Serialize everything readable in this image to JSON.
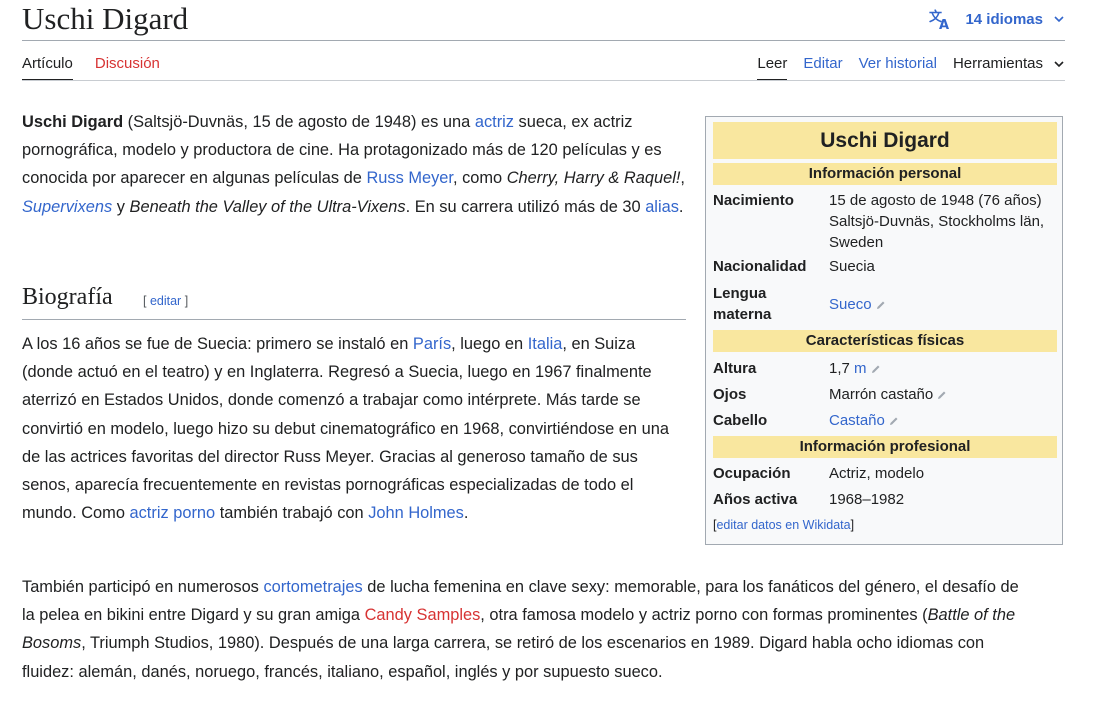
{
  "header": {
    "title": "Uschi Digard",
    "languages": "14 idiomas"
  },
  "tabs": {
    "articulo": "Artículo",
    "discusion": "Discusión",
    "leer": "Leer",
    "editar": "Editar",
    "historial": "Ver historial",
    "herramientas": "Herramientas"
  },
  "intro": {
    "name": "Uschi Digard",
    "t1": " (Saltsjö-Duvnäs, 15 de agosto de 1948) es una ",
    "l_actriz": "actriz",
    "t2": " sueca, ex actriz pornográfica, modelo y productora de cine. Ha protagonizado más de 120 películas y es conocida por aparecer en algunas películas de ",
    "l_russ": "Russ Meyer",
    "t3": ", como ",
    "i_cherry": "Cherry, Harry & Raquel!",
    "t4": ", ",
    "l_super": "Supervixens",
    "t5": " y ",
    "i_beneath": "Beneath the Valley of the Ultra-Vixens",
    "t6": ". En su carrera utilizó más de 30 ",
    "l_alias": "alias",
    "t7": "."
  },
  "section": {
    "heading": "Biografía",
    "edit_open": "[ ",
    "edit_link": "editar",
    "edit_close": " ]"
  },
  "bio": {
    "t1": "A los 16 años se fue de Suecia: primero se instaló en ",
    "l_paris": "París",
    "t2": ", luego en ",
    "l_italia": "Italia",
    "t3": ", en Suiza (donde actuó en el teatro) y en Inglaterra. Regresó a Suecia, luego en 1967 finalmente aterrizó en Estados Unidos, donde comenzó a trabajar como intérprete. Más tarde se convirtió en modelo, luego hizo su debut cinematográfico en 1968, convirtiéndose en una de las actrices favoritas del director Russ Meyer. Gracias al generoso tamaño de sus senos, aparecía frecuentemente en revistas pornográficas especializadas de todo el mundo. Como ",
    "l_porno": "actriz porno",
    "t4": " también trabajó con ",
    "l_john": "John Holmes",
    "t5": "."
  },
  "bio2": {
    "t1": "También participó en numerosos ",
    "l_corto": "cortometrajes",
    "t2": " de lucha femenina en clave sexy: memorable, para los fanáticos del género, el desafío de la pelea en bikini entre Digard y su gran amiga ",
    "l_candy": "Candy Samples",
    "t3": ", otra famosa modelo y actriz porno con formas prominentes (",
    "i_battle": "Battle of the Bosoms",
    "t4": ", Triumph Studios, 1980). Después de una larga carrera, se retiró de los escenarios en 1989. Digard habla ocho idiomas con fluidez: alemán, danés, noruego, francés, italiano, español, inglés y por supuesto sueco."
  },
  "infobox": {
    "title": "Uschi Digard",
    "sec_personal": "Información personal",
    "nacimiento_k": "Nacimiento",
    "nacimiento_v1": "15 de agosto de 1948 (76 años)",
    "nacimiento_v2": "Saltsjö-Duvnäs, Stockholms län,",
    "nacimiento_v3": "Sweden",
    "nacionalidad_k": "Nacionalidad",
    "nacionalidad_v": "Suecia",
    "lengua_k1": "Lengua",
    "lengua_k2": "materna",
    "lengua_v": "Sueco",
    "sec_fisicas": "Características físicas",
    "altura_k": "Altura",
    "altura_v": "1,7",
    "altura_unit": "m",
    "ojos_k": "Ojos",
    "ojos_v": "Marrón castaño",
    "cabello_k": "Cabello",
    "cabello_v": "Castaño",
    "sec_prof": "Información profesional",
    "ocupacion_k": "Ocupación",
    "ocupacion_v": "Actriz, modelo",
    "anos_k": "Años activa",
    "anos_v": "1968–1982",
    "foot_open": "[",
    "foot_link": "editar datos en Wikidata",
    "foot_close": "]"
  },
  "colors": {
    "link": "#3366cc",
    "redlink": "#d73333",
    "infobox_header": "#f9e79f"
  },
  "icons": [
    "translate-icon",
    "chevron-down-icon",
    "pencil-icon"
  ]
}
